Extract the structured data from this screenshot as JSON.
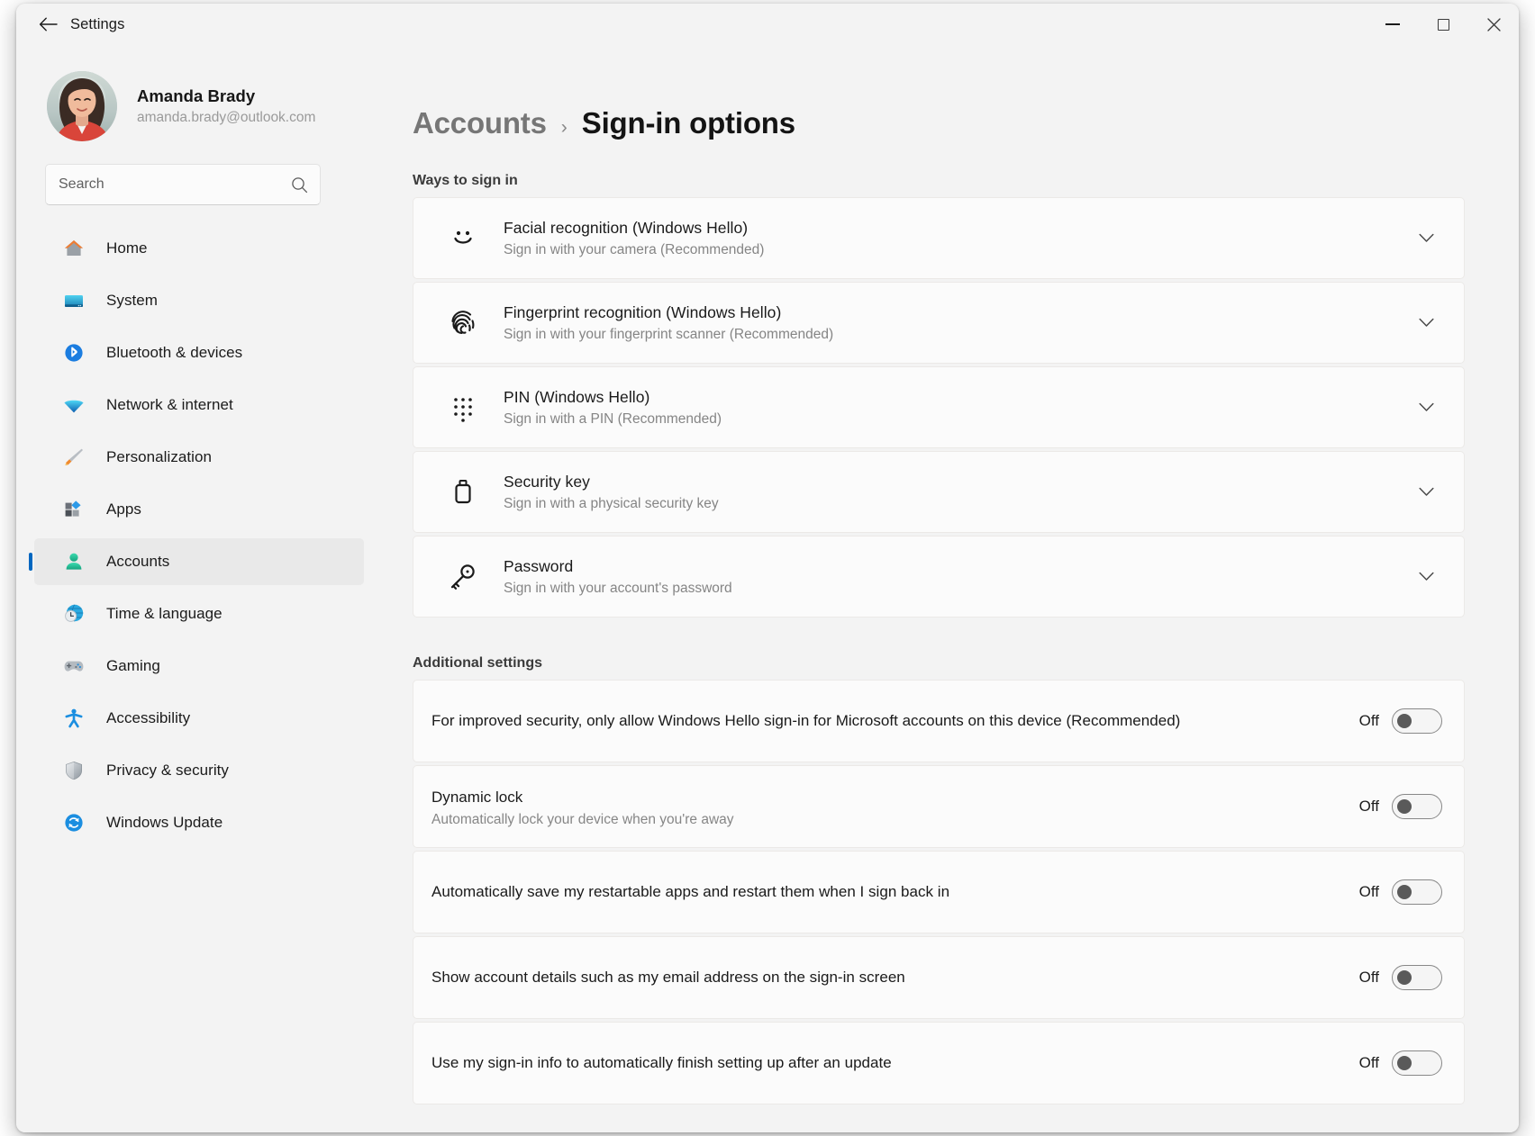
{
  "window": {
    "title": "Settings",
    "back_label": "back-arrow",
    "controls": {
      "minimize": "minimize",
      "maximize": "maximize",
      "close": "close"
    }
  },
  "sidebar": {
    "profile": {
      "name": "Amanda Brady",
      "email": "amanda.brady@outlook.com"
    },
    "search": {
      "placeholder": "Search",
      "value": ""
    },
    "items": [
      {
        "label": "Home",
        "icon": "home-icon",
        "selected": false
      },
      {
        "label": "System",
        "icon": "monitor-icon",
        "selected": false
      },
      {
        "label": "Bluetooth & devices",
        "icon": "bluetooth-icon",
        "selected": false
      },
      {
        "label": "Network & internet",
        "icon": "wifi-icon",
        "selected": false
      },
      {
        "label": "Personalization",
        "icon": "paintbrush-icon",
        "selected": false
      },
      {
        "label": "Apps",
        "icon": "apps-icon",
        "selected": false
      },
      {
        "label": "Accounts",
        "icon": "person-icon",
        "selected": true
      },
      {
        "label": "Time & language",
        "icon": "clock-globe-icon",
        "selected": false
      },
      {
        "label": "Gaming",
        "icon": "gamepad-icon",
        "selected": false
      },
      {
        "label": "Accessibility",
        "icon": "accessibility-icon",
        "selected": false
      },
      {
        "label": "Privacy & security",
        "icon": "shield-icon",
        "selected": false
      },
      {
        "label": "Windows Update",
        "icon": "refresh-icon",
        "selected": false
      }
    ]
  },
  "main": {
    "breadcrumb": {
      "parent": "Accounts",
      "separator": "›",
      "current": "Sign-in options"
    },
    "ways_heading": "Ways to sign in",
    "signin_options": [
      {
        "title": "Facial recognition (Windows Hello)",
        "subtitle": "Sign in with your camera (Recommended)",
        "icon": "smiley-face-icon"
      },
      {
        "title": "Fingerprint recognition (Windows Hello)",
        "subtitle": "Sign in with your fingerprint scanner (Recommended)",
        "icon": "fingerprint-icon"
      },
      {
        "title": "PIN (Windows Hello)",
        "subtitle": "Sign in with a PIN (Recommended)",
        "icon": "pin-keypad-icon"
      },
      {
        "title": "Security key",
        "subtitle": "Sign in with a physical security key",
        "icon": "usb-key-icon"
      },
      {
        "title": "Password",
        "subtitle": "Sign in with your account's password",
        "icon": "key-icon"
      }
    ],
    "additional_heading": "Additional settings",
    "additional_settings": [
      {
        "title": "For improved security, only allow Windows Hello sign-in for Microsoft accounts on this device (Recommended)",
        "subtitle": "",
        "state": "Off"
      },
      {
        "title": "Dynamic lock",
        "subtitle": "Automatically lock your device when you're away",
        "state": "Off"
      },
      {
        "title": "Automatically save my restartable apps and restart them when I sign back in",
        "subtitle": "",
        "state": "Off"
      },
      {
        "title": "Show account details such as my email address on the sign-in screen",
        "subtitle": "",
        "state": "Off"
      },
      {
        "title": "Use my sign-in info to automatically finish setting up after an update",
        "subtitle": "",
        "state": "Off"
      }
    ]
  },
  "colors": {
    "accent": "#0067c0",
    "window_bg": "#f3f3f3",
    "card_bg": "#fbfbfb",
    "selected_bg": "#e9e9e9"
  }
}
